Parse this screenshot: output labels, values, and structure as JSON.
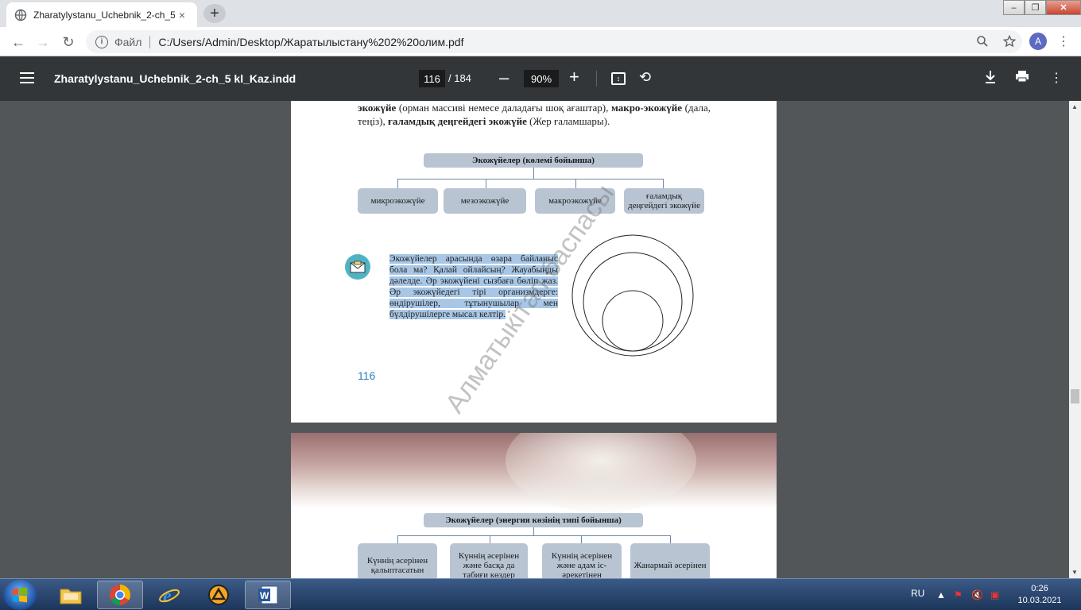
{
  "browser": {
    "tab_title": "Zharatylystanu_Uchebnik_2-ch_5",
    "tab_close": "×",
    "new_tab": "+",
    "window_controls": [
      "–",
      "❐",
      "✕"
    ],
    "nav": {
      "back": "←",
      "forward": "→",
      "reload": "↻"
    },
    "address": {
      "info": "i",
      "scheme": "Файл",
      "url": "C:/Users/Admin/Desktop/Жаратылыстану%202%20олим.pdf"
    },
    "profile_initial": "A",
    "icons": [
      "zoom-icon",
      "star-icon",
      "menu-dots-icon"
    ]
  },
  "pdf_toolbar": {
    "title": "Zharatylystanu_Uchebnik_2-ch_5 kl_Kaz.indd",
    "current_page": "116",
    "total_pages": "/ 184",
    "zoom": "90%",
    "zoom_out": "–",
    "zoom_in": "+"
  },
  "page1": {
    "text_parts": {
      "t1": "экожүйе",
      "t2": " (орман массиві немесе даладағы шоқ ағаштар), ",
      "t3": "макро-экожүйе",
      "t4": " (дала, теңіз), ",
      "t5": "ғаламдық деңгейдегі экожүйе",
      "t6": " (Жер ғаламшары)."
    },
    "diagram_title": "Экожүйелер (көлемі бойынша)",
    "diagram_boxes": [
      "микроэкожүйе",
      "мезоэкожүйе",
      "макроэкожүйе",
      "ғаламдық деңгейдегі экожүйе"
    ],
    "question": "Экожүйелер арасында өзара байланыс бола ма? Қалай ойлайсың? Жауабыңды дәлелде. Әр экожүйені сызбаға бөліп жаз. Әр экожүйедегі тірі организмдерге: өндірушілер, тұтынушылар мен бүлдірушілерге мысал келтір.",
    "page_number": "116",
    "watermark": "Алматыкітап баспасы"
  },
  "page2": {
    "diagram_title": "Экожүйелер (энергия көзінің типі бойынша)",
    "diagram_boxes": [
      "Күннің әсерінен қалыптасатын",
      "Күннің әсерінен және басқа да табиғи көздер",
      "Күннің әсерінен және адам іс-әрекетінен",
      "Жанармай әсерінен"
    ]
  },
  "taskbar": {
    "language": "RU",
    "time": "0:26",
    "date": "10.03.2021"
  },
  "colors": {
    "chrome_tabstrip": "#dee1e6",
    "pdf_toolbar": "#323639",
    "viewer_bg": "#525659",
    "diagram_box": "#b8c4d2",
    "highlight": "#a8c7e6",
    "page_number": "#2e7fb8"
  }
}
